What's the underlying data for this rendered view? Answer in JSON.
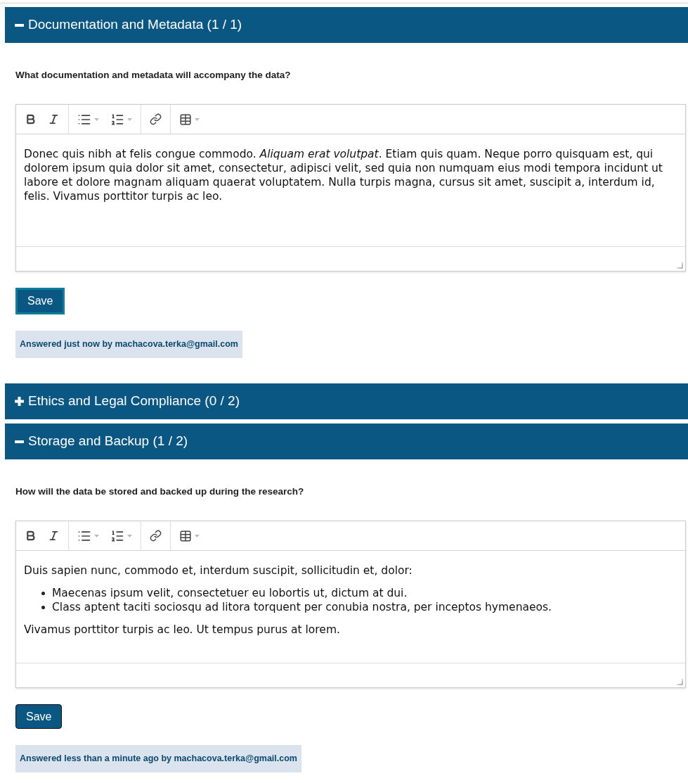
{
  "sections": [
    {
      "title": "Documentation and Metadata (1 / 1)",
      "expanded": true,
      "question": "What documentation and metadata will accompany the data?",
      "answer": [
        {
          "kind": "paragraph",
          "text": "Donec quis nibh at felis congue commodo. *Aliquam erat volutpat*. Etiam quis quam. Neque porro quisquam est, qui dolorem ipsum quia dolor sit amet, consectetur, adipisci velit, sed quia non numquam eius modi tempora incidunt ut labore et dolore magnam aliquam quaerat voluptatem. Nulla turpis magna, cursus sit amet, suscipit a, interdum id, felis. Vivamus porttitor turpis ac leo."
        }
      ],
      "save": {
        "label": "Save",
        "focused": true
      },
      "status": "Answered just now by machacova.terka@gmail.com"
    },
    {
      "title": "Ethics and Legal Compliance (0 / 2)",
      "expanded": false
    },
    {
      "title": "Storage and Backup (1 / 2)",
      "expanded": true,
      "question": "How will the data be stored and backed up during the research?",
      "answer": [
        {
          "kind": "paragraph",
          "text": "Duis sapien nunc, commodo et, interdum suscipit, sollicitudin et, dolor:"
        },
        {
          "kind": "list",
          "items": [
            "Maecenas ipsum velit, consectetuer eu lobortis ut, dictum at dui.",
            "Class aptent taciti sociosqu ad litora torquent per conubia nostra, per inceptos hymenaeos."
          ]
        },
        {
          "kind": "paragraph",
          "text": "Vivamus porttitor turpis ac leo. Ut tempus purus at lorem."
        }
      ],
      "save": {
        "label": "Save",
        "focused": false
      },
      "status": "Answered less than a minute ago by machacova.terka@gmail.com"
    }
  ]
}
